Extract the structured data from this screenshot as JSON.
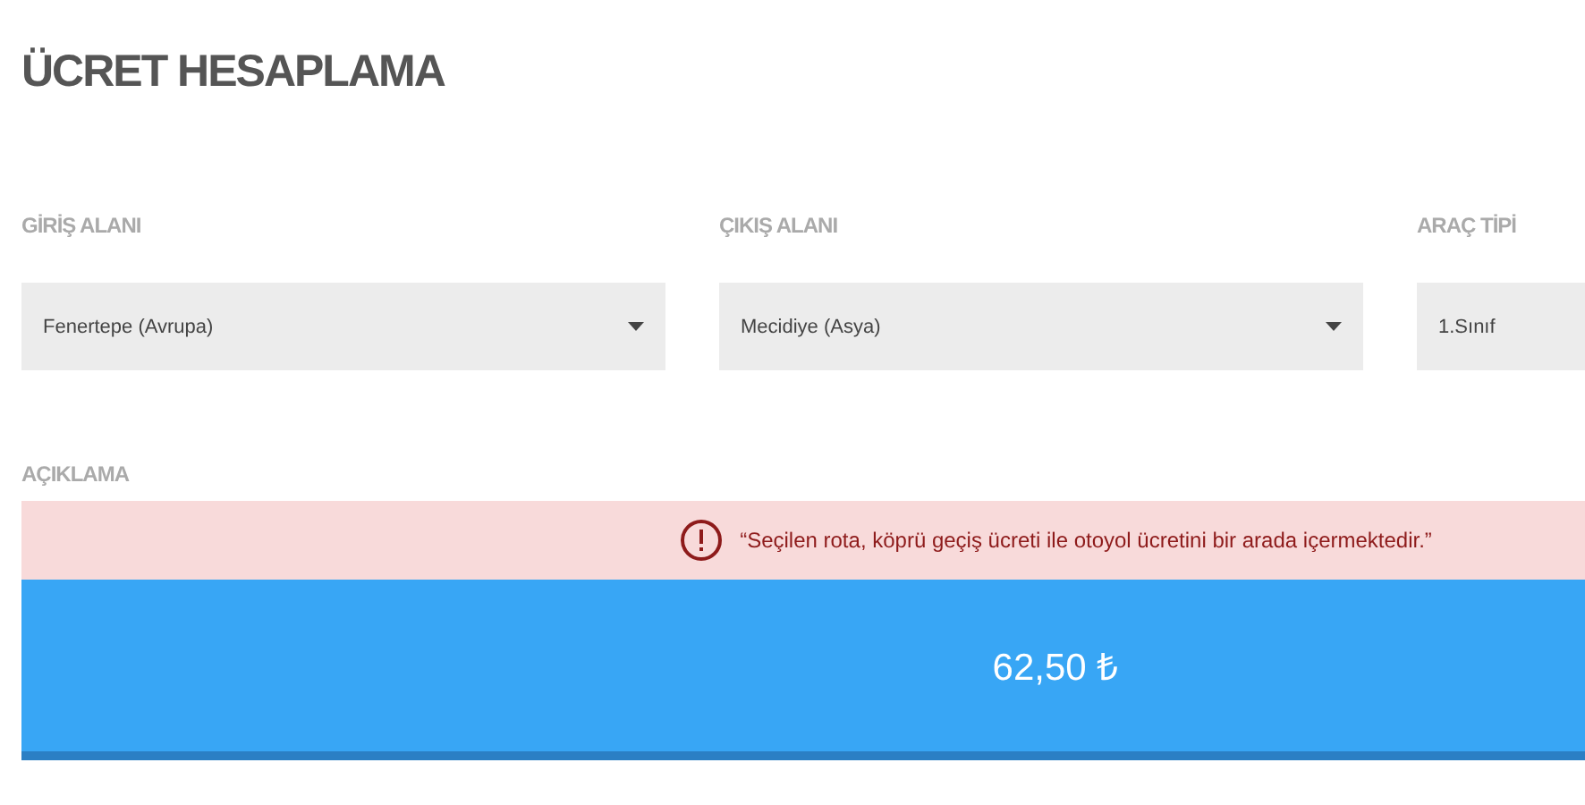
{
  "title": "ÜCRET HESAPLAMA",
  "fields": [
    {
      "label": "GİRİŞ ALANI",
      "value": "Fenertepe (Avrupa)"
    },
    {
      "label": "ÇIKIŞ ALANI",
      "value": "Mecidiye (Asya)"
    },
    {
      "label": "ARAÇ TİPİ",
      "value": "1.Sınıf"
    }
  ],
  "description": {
    "label": "AÇIKLAMA",
    "message": "“Seçilen rota, köprü geçiş ücreti ile otoyol ücretini bir arada içermektedir.”"
  },
  "fare": "62,50 ₺"
}
